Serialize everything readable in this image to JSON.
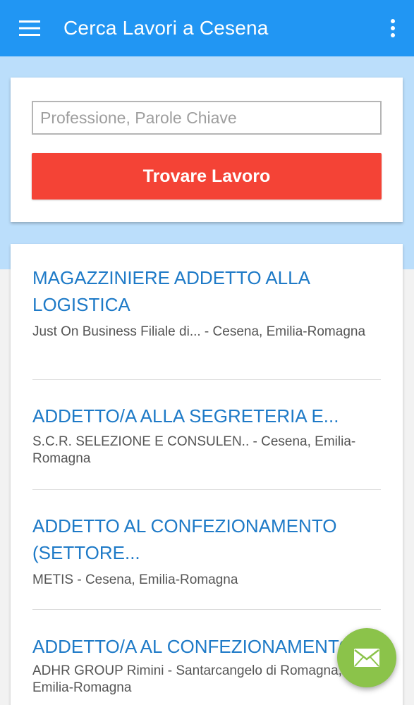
{
  "appbar": {
    "title": "Cerca Lavori a Cesena",
    "menu_icon": "hamburger-menu-icon",
    "more_icon": "more-vert-icon",
    "color": "#2196f3"
  },
  "search": {
    "placeholder": "Professione, Parole Chiave",
    "value": "",
    "button_label": "Trovare Lavoro",
    "button_color": "#f44336"
  },
  "jobs": [
    {
      "title": "MAGAZZINIERE ADDETTO ALLA LOGISTICA",
      "meta": "Just On Business Filiale di... - Cesena, Emilia-Romagna"
    },
    {
      "title": "ADDETTO/A ALLA SEGRETERIA E...",
      "meta": "S.C.R. SELEZIONE E CONSULEN.. - Cesena, Emilia-Romagna"
    },
    {
      "title": "ADDETTO AL CONFEZIONAMENTO (SETTORE...",
      "meta": "METIS - Cesena, Emilia-Romagna"
    },
    {
      "title": "ADDETTO/A AL CONFEZIONAMENTO",
      "meta": "ADHR GROUP Rimini - Santarcangelo di Romagna, Emilia-Romagna"
    }
  ],
  "fab": {
    "icon": "email-icon",
    "color": "#8bc34a"
  }
}
